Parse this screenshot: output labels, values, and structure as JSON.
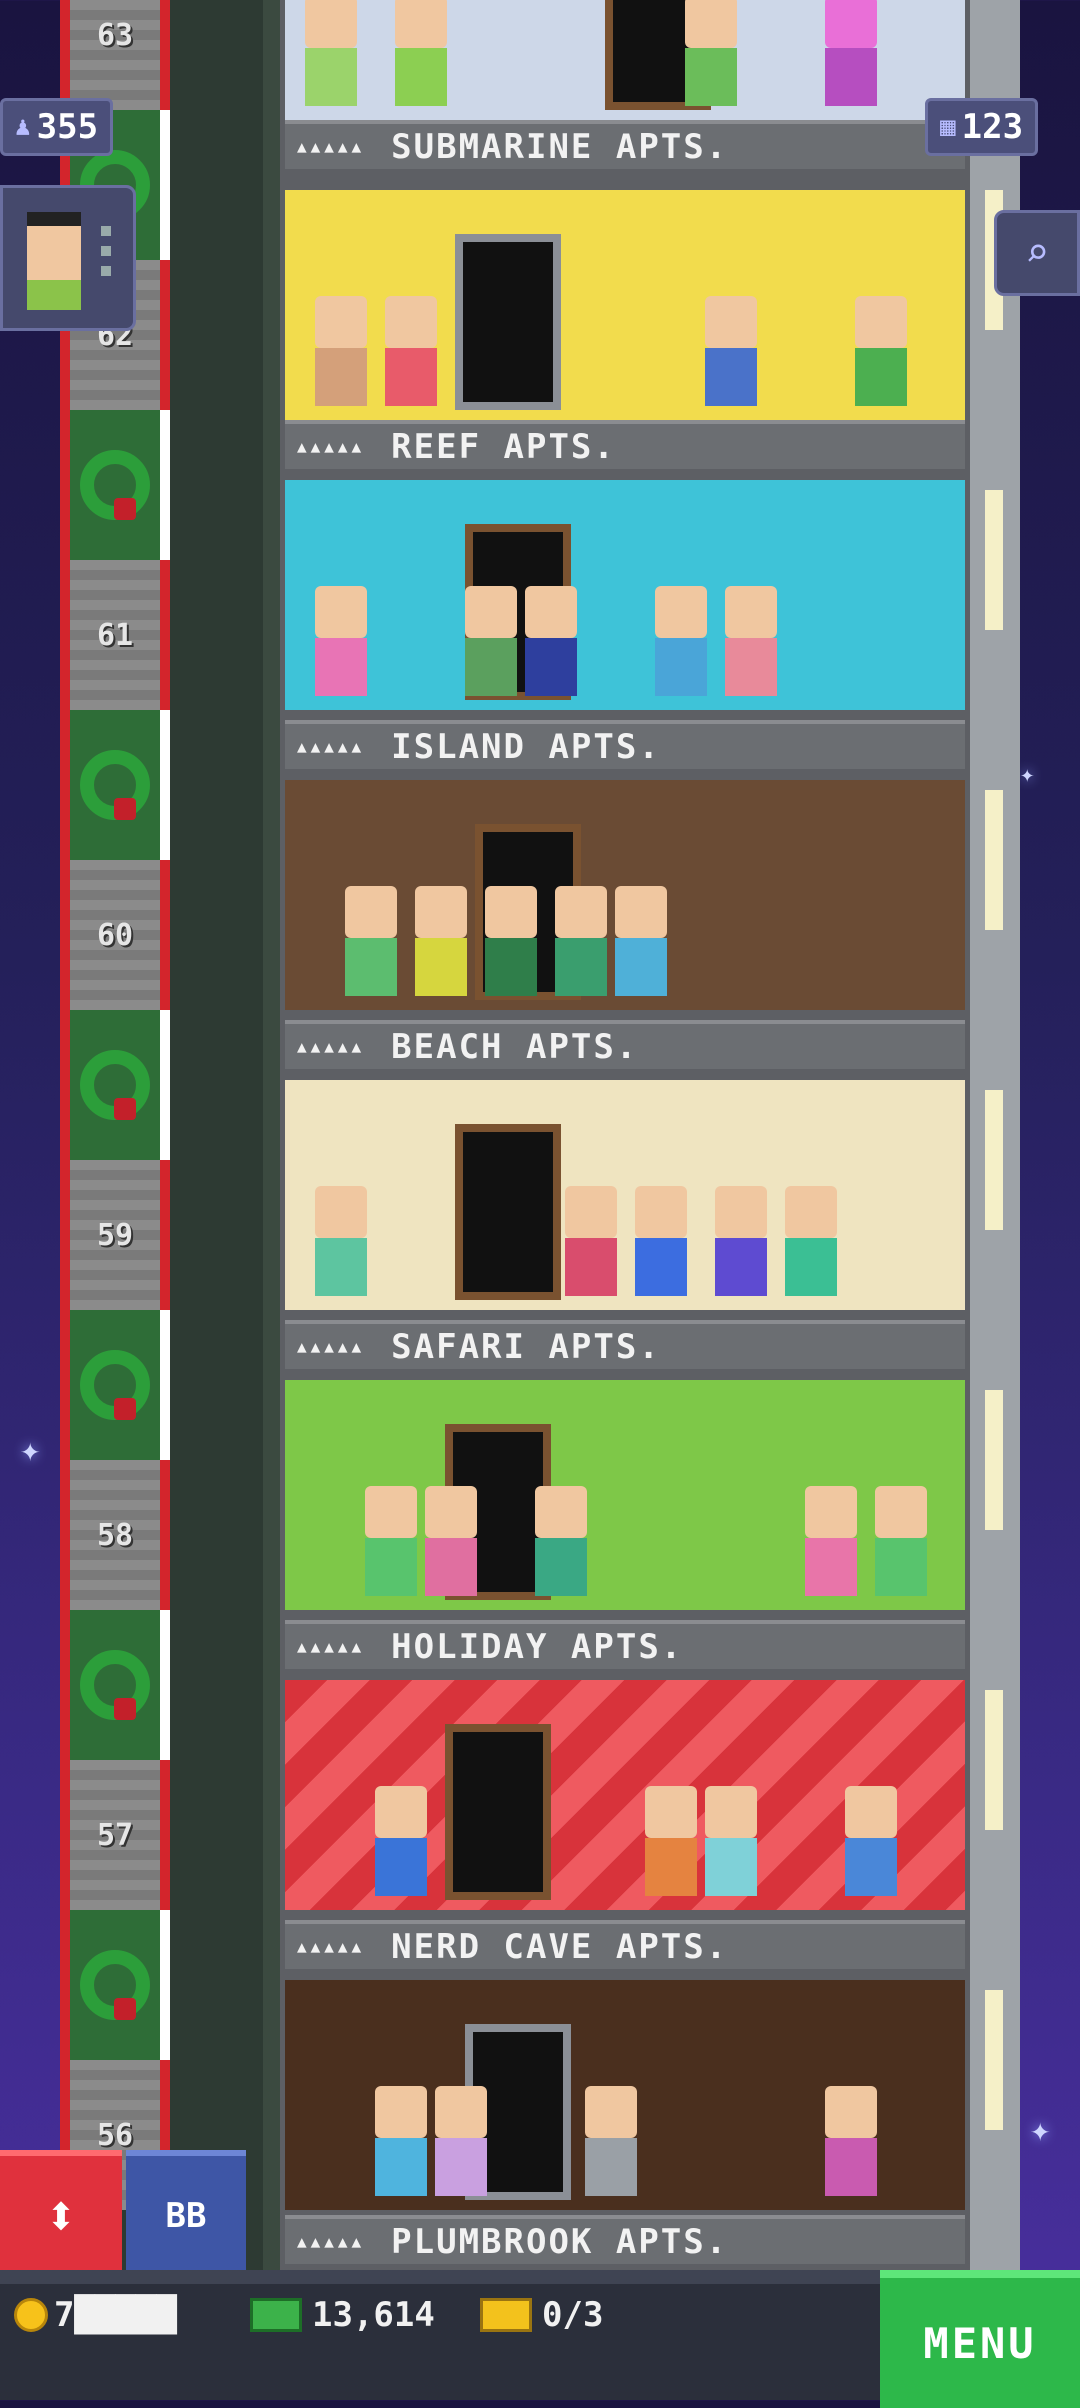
{
  "hud": {
    "population": "355",
    "floor_count": "123",
    "coins": "7█████",
    "bux": "13,614",
    "tickets": "0/3"
  },
  "buttons": {
    "bb": "BB",
    "menu": "MENU",
    "elevator": "⬍"
  },
  "icons": {
    "population": "person-icon",
    "floors": "building-icon",
    "search": "magnifier-icon",
    "coin": "coin-icon",
    "bux": "tower-bux-icon",
    "tickets": "golden-ticket-icon"
  },
  "shaft_floors": [
    "63",
    "62",
    "61",
    "60",
    "59",
    "58",
    "57",
    "56"
  ],
  "floors": [
    {
      "name": "SUBMARINE APTS.",
      "stars": "▲▲▲▲▲",
      "theme_color": "#f2dc4d"
    },
    {
      "name": "REEF APTS.",
      "stars": "▲▲▲▲▲",
      "theme_color": "#3ec3d8"
    },
    {
      "name": "ISLAND APTS.",
      "stars": "▲▲▲▲▲",
      "theme_color": "#6a4b34"
    },
    {
      "name": "BEACH APTS.",
      "stars": "▲▲▲▲▲",
      "theme_color": "#efe4c0"
    },
    {
      "name": "SAFARI APTS.",
      "stars": "▲▲▲▲▲",
      "theme_color": "#7ec848"
    },
    {
      "name": "HOLIDAY APTS.",
      "stars": "▲▲▲▲▲",
      "theme_color": "#d8333b"
    },
    {
      "name": "NERD CAVE APTS.",
      "stars": "▲▲▲▲▲",
      "theme_color": "#4a2f1e"
    },
    {
      "name": "PLUMBROOK APTS.",
      "stars": "▲▲▲▲▲",
      "theme_color": "#5a5d64"
    }
  ]
}
